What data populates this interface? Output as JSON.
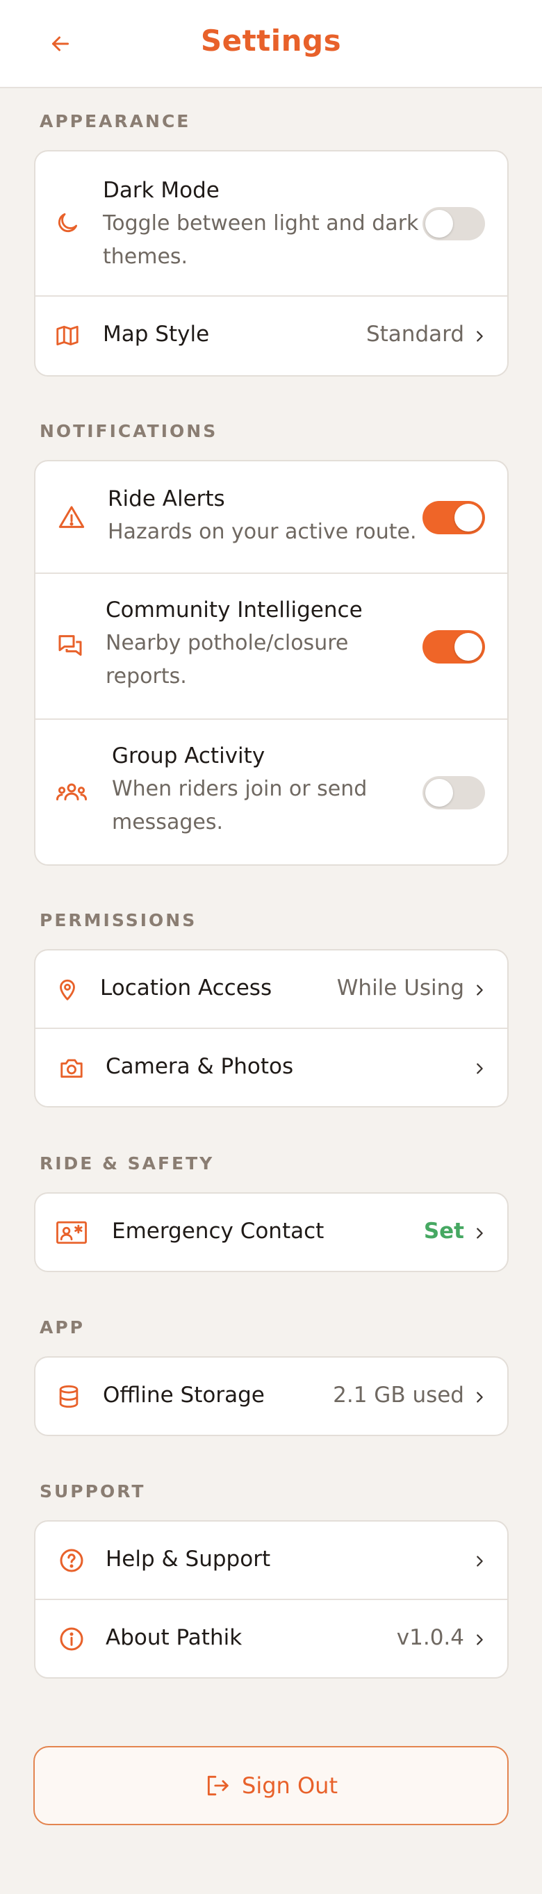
{
  "header": {
    "title": "Settings"
  },
  "colors": {
    "accent": "#e8612a",
    "toggle_on": "#ef6528",
    "set_green": "#46a862"
  },
  "sections": {
    "appearance": "APPEARANCE",
    "notifications": "NOTIFICATIONS",
    "permissions": "PERMISSIONS",
    "ride_safety": "RIDE & SAFETY",
    "app": "APP",
    "support": "SUPPORT"
  },
  "appearance": {
    "dark_mode": {
      "title": "Dark Mode",
      "sub": "Toggle between light and dark themes.",
      "on": false,
      "icon": "moon-icon"
    },
    "map_style": {
      "title": "Map Style",
      "value": "Standard",
      "icon": "map-icon"
    }
  },
  "notifications": {
    "ride_alerts": {
      "title": "Ride Alerts",
      "sub": "Hazards on your active route.",
      "on": true,
      "icon": "warning-icon"
    },
    "community": {
      "title": "Community Intelligence",
      "sub": "Nearby pothole/closure reports.",
      "on": true,
      "icon": "chat-icon"
    },
    "group": {
      "title": "Group Activity",
      "sub": "When riders join or send messages.",
      "on": false,
      "icon": "group-icon"
    }
  },
  "permissions": {
    "location": {
      "title": "Location Access",
      "value": "While Using",
      "icon": "location-pin-icon"
    },
    "camera": {
      "title": "Camera & Photos",
      "icon": "camera-icon"
    }
  },
  "ride_safety": {
    "emergency": {
      "title": "Emergency Contact",
      "value": "Set",
      "icon": "emergency-contact-icon"
    }
  },
  "app": {
    "storage": {
      "title": "Offline Storage",
      "value": "2.1 GB used",
      "icon": "database-icon"
    }
  },
  "support": {
    "help": {
      "title": "Help & Support",
      "icon": "help-icon"
    },
    "about": {
      "title": "About Pathik",
      "value": "v1.0.4",
      "icon": "info-icon"
    }
  },
  "signout": {
    "label": "Sign Out",
    "icon": "sign-out-icon"
  }
}
